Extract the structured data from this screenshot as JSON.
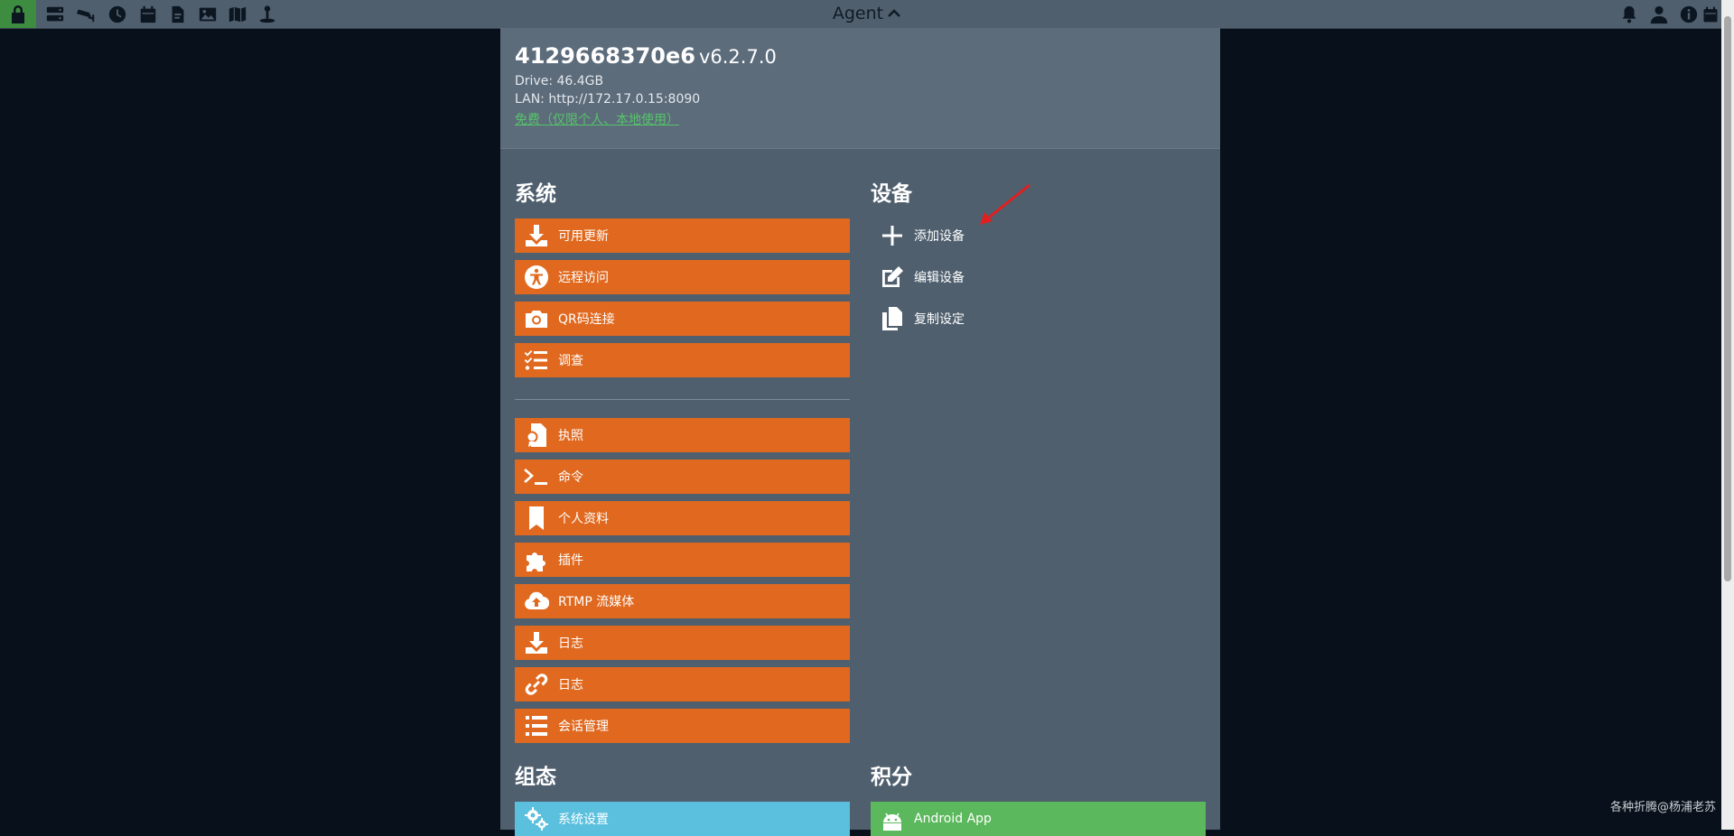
{
  "topbar": {
    "title": "Agent",
    "left_icons": [
      "lock-icon",
      "server-icon",
      "cctv-icon",
      "clock-icon",
      "calendar-icon",
      "file-icon",
      "image-icon",
      "map-icon",
      "user-pin-icon"
    ],
    "right_icons": [
      "bell-icon",
      "user-icon",
      "info-icon",
      "calendar-icon"
    ],
    "lock_color": "#3d8c3f"
  },
  "device": {
    "name": "4129668370e6",
    "version": "v6.2.7.0",
    "drive": "Drive: 46.4GB",
    "lan": "LAN: http://172.17.0.15:8090",
    "license": "免费（仅限个人、本地使用）"
  },
  "system": {
    "title": "系统",
    "buttons": [
      {
        "label": "可用更新",
        "icon": "download-icon"
      },
      {
        "label": "远程访问",
        "icon": "accessibility-icon"
      },
      {
        "label": "QR码连接",
        "icon": "camera-icon"
      },
      {
        "label": "调查",
        "icon": "checklist-icon"
      }
    ],
    "buttons2": [
      {
        "label": "执照",
        "icon": "certificate-icon"
      },
      {
        "label": "命令",
        "icon": "terminal-icon"
      },
      {
        "label": "个人资料",
        "icon": "bookmark-icon"
      },
      {
        "label": "插件",
        "icon": "puzzle-icon"
      },
      {
        "label": "RTMP 流媒体",
        "icon": "cloud-upload-icon"
      },
      {
        "label": "日志",
        "icon": "download-icon"
      },
      {
        "label": "日志",
        "icon": "link-icon"
      },
      {
        "label": "会话管理",
        "icon": "list-icon"
      }
    ]
  },
  "devices": {
    "title": "设备",
    "items": [
      {
        "label": "添加设备",
        "icon": "plus-icon"
      },
      {
        "label": "编辑设备",
        "icon": "edit-icon"
      },
      {
        "label": "复制设定",
        "icon": "copy-icon"
      }
    ]
  },
  "config": {
    "title": "组态",
    "button": {
      "label": "系统设置",
      "icon": "cogs-icon"
    }
  },
  "credits": {
    "title": "积分",
    "button": {
      "label": "Android App",
      "icon": "android-icon"
    }
  },
  "watermark": "各种折腾@杨浦老苏",
  "colors": {
    "background": "#08111b",
    "panel": "#4f5f6e",
    "header": "#5c6c7b",
    "orange": "#e0691f",
    "blue": "#5bc0de",
    "green": "#5cb85c",
    "link_green": "#56c46a",
    "arrow_red": "#e02020"
  }
}
